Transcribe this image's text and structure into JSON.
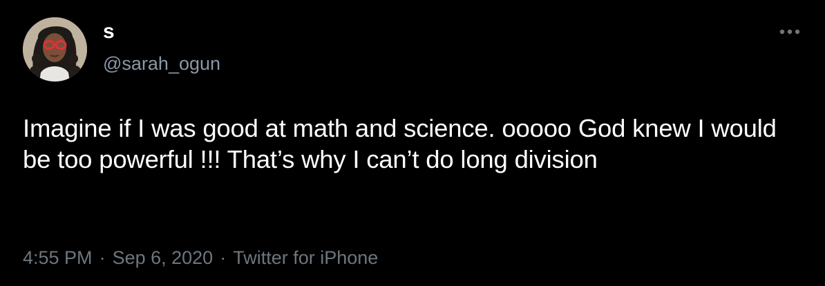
{
  "author": {
    "display_name": "s",
    "handle": "@sarah_ogun",
    "avatar_icon": "profile-photo"
  },
  "more_icon": "more-options-icon",
  "tweet": {
    "text": "Imagine if I was good at math and science. ooooo God knew I would be too powerful !!! That’s why I can’t do long division"
  },
  "meta": {
    "time": "4:55 PM",
    "separator": "·",
    "date": "Sep 6, 2020",
    "source": "Twitter for iPhone"
  },
  "colors": {
    "background": "#000000",
    "primary_text": "#ffffff",
    "secondary_text": "#8b98a5",
    "meta_text": "#6e767d"
  }
}
